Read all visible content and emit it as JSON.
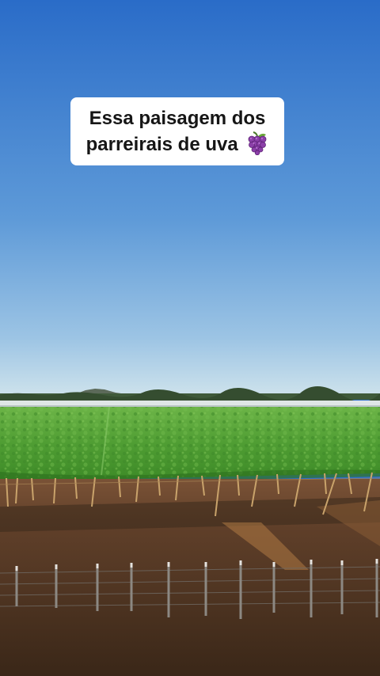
{
  "caption": {
    "line1": "Essa paisagem dos",
    "line2": "parreirais de uva",
    "emoji_icon": "grapes-icon"
  },
  "colors": {
    "sky_top": "#2a6cc8",
    "sky_horizon": "#cfe3ec",
    "vineyard": "#4a9a2f",
    "soil": "#5b3c27",
    "caption_bg": "#ffffff",
    "caption_text": "#161616"
  }
}
